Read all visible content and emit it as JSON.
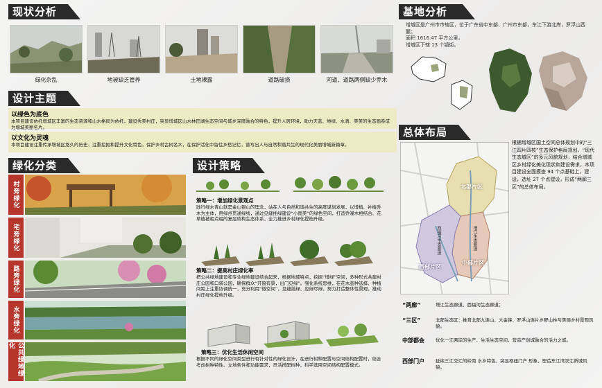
{
  "section_titles": {
    "current": "现状分析",
    "site": "基地分析",
    "theme": "设计主题",
    "layout": "总体布局",
    "greening": "绿化分类",
    "strategy": "设计策略"
  },
  "current_photos": [
    {
      "label": "绿化杂乱"
    },
    {
      "label": "地被缺乏管养"
    },
    {
      "label": "土地裸露"
    },
    {
      "label": "道路破损"
    },
    {
      "label": "河道、道路两侧缺少乔木"
    }
  ],
  "site_text": [
    "增城区是广州市市辖区，位于广东省中东部、广州市东部，东江下游北岸，罗浮山西麓；",
    "面积 1616.47 平方公里，",
    "增城区下辖 13 个镇街。"
  ],
  "theme": {
    "green_title": "以绿色为底色",
    "green_text": "本项目建设依托增城区丰富的生态资源和山水格局为依托，建设秀美村庄，突显增城区山水林田湖生态空间与城乡深度融合的特色，提升人居环境，助力天蓝、地绿、水清、美美的生态画卷成为增城美丽名片。",
    "culture_title": "以文化为灵魂",
    "culture_text": "本项目建设注重传承增城区悠久的历史，注重挖掘和提升文化特色，保护乡村古树名木，在保护活化中留住乡愁记忆，谱写出人与自然和谐共生的现代化美丽增城新篇章。"
  },
  "categories": [
    "村旁绿化",
    "宅旁绿化",
    "路旁绿化",
    "水旁绿化",
    "公共绿地绿化"
  ],
  "strategy": {
    "s1_title": "策略一：增加绿化景观点",
    "s1_text": "践行绿水青山就是金山银山的理念，站在人与自然和谐共生的高度谋划发展，以增植、补植乔木为主体，用绿点贯通绿线，通过见缝插绿建设“小而美”的绿色空间，打造乔灌木相结合、花草植被相点缀的复层结构生态体系，全力推进乡村绿化提档升级。",
    "s2_title": "策略二：提高村庄绿化率",
    "s2_text": "把公共绿地建设和专业绿地建设结合起来，根据地域特点，挖掘“增绿”空间，多种形式共建村庄公园和口袋公园，确保群众“开窗有景，出门见绿”。强化系统思维，在花木品种选择、种植间距上注重协调统一，充分利用“微空间”，见缝插绿、应绿尽绿，努力打造整体性景观，推动村庄绿化提档升级。",
    "s3_title": "策略三：优化生活休闲空间",
    "s3_text": "根据不同的绿化空间类型进行有针对性的绿化设计，在进行树种配置与空间结构配置时，结合考虑树种特性、立地条件和功能需求，灵活搭配树种，科学选用空间结构配置模式。"
  },
  "layout_text": "根据增城区国土空间总体规划中的“三江四片四核”生态保护格局规划、“现代生态城区”的多元风貌规划，结合增城区乡村绿化美化现状和建设需求，本项目建设全面摸查 94 个点基础上，建设，选址 27 个点建设，形成“两廊三区”的总体布局。",
  "map_labels": {
    "north": "北部片区",
    "middle": "中部片区",
    "west": "西部片区",
    "river1": "增江生态廊道",
    "river2": "西福河生态廊道"
  },
  "legend": [
    {
      "label": "“两廊”",
      "text": "增江生态廊道、西福河生态廊道；"
    },
    {
      "label": "“三区”",
      "text": "北部生态区：推育北部九连山、大金锋、罗浮山连片乡野山林与美丽乡村景观风貌。"
    },
    {
      "label": "中部都会",
      "text": "优化一江两岸的生产、生活生态空间，营造产创城融合的活力之城。"
    },
    {
      "label": "西部门户",
      "text": "延续三江交汇的岭南 水乡特色，突显枢纽门户 形象，塑造东江湾滨江新城风貌。"
    }
  ],
  "colors": {
    "header": "#2a2a2a",
    "band": "#ecebc4",
    "category": "#b6362b",
    "north": "#e8dfb0",
    "middle": "#e6c9b8",
    "west": "#cfc8df"
  }
}
